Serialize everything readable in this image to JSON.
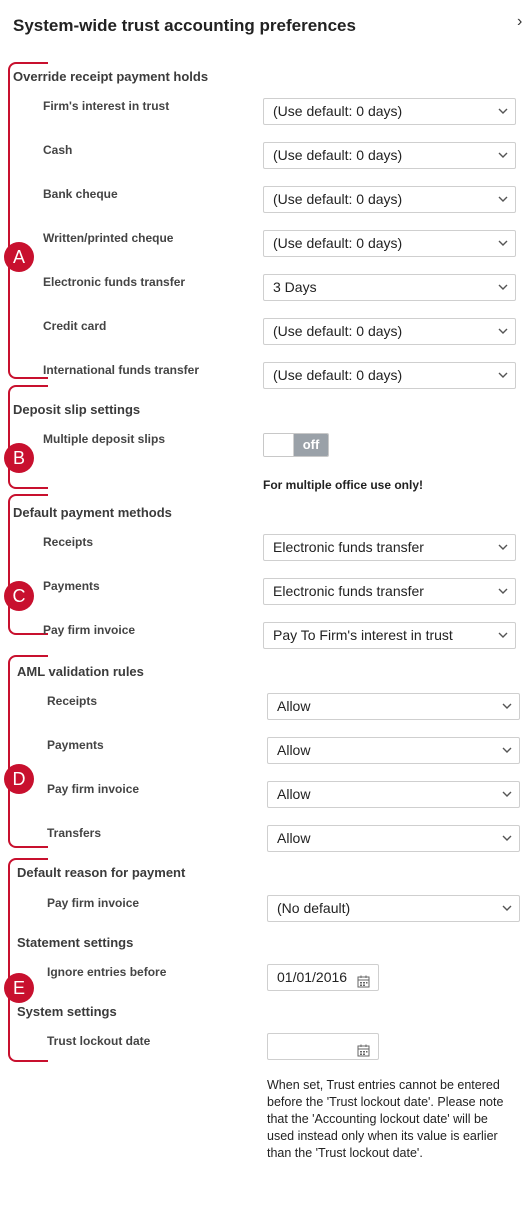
{
  "dialog": {
    "title": "System-wide trust accounting preferences",
    "close_icon": "close-icon",
    "close_glyph": "›"
  },
  "override_holds": {
    "heading": "Override receipt payment holds",
    "rows": [
      {
        "label": "Firm's interest in trust",
        "value": "(Use default: 0 days)"
      },
      {
        "label": "Cash",
        "value": "(Use default: 0 days)"
      },
      {
        "label": "Bank cheque",
        "value": "(Use default: 0 days)"
      },
      {
        "label": "Written/printed cheque",
        "value": "(Use default: 0 days)"
      },
      {
        "label": "Electronic funds transfer",
        "value": "3 Days"
      },
      {
        "label": "Credit card",
        "value": "(Use default: 0 days)"
      },
      {
        "label": "International funds transfer",
        "value": "(Use default: 0 days)"
      }
    ]
  },
  "deposit_slip": {
    "heading": "Deposit slip settings",
    "label": "Multiple deposit slips",
    "toggle_state": "off",
    "note": "For multiple office use only!"
  },
  "payment_methods": {
    "heading": "Default payment methods",
    "rows": [
      {
        "label": "Receipts",
        "value": "Electronic funds transfer"
      },
      {
        "label": "Payments",
        "value": "Electronic funds transfer"
      },
      {
        "label": "Pay firm invoice",
        "value": "Pay To Firm's interest in trust"
      }
    ]
  },
  "aml": {
    "heading": "AML validation rules",
    "rows": [
      {
        "label": "Receipts",
        "value": "Allow"
      },
      {
        "label": "Payments",
        "value": "Allow"
      },
      {
        "label": "Pay firm invoice",
        "value": "Allow"
      },
      {
        "label": "Transfers",
        "value": "Allow"
      }
    ]
  },
  "reason": {
    "heading": "Default reason for payment",
    "label": "Pay firm invoice",
    "value": "(No default)"
  },
  "statement": {
    "heading": "Statement settings",
    "label": "Ignore entries before",
    "value": "01/01/2016"
  },
  "system": {
    "heading": "System settings",
    "label": "Trust lockout date",
    "value": "",
    "note": "When set, Trust entries cannot be entered before the 'Trust lockout date'. Please note that the 'Accounting lockout date' will be used instead only when its value is earlier than the 'Trust lockout date'."
  },
  "annotations": {
    "badges": [
      "A",
      "B",
      "C",
      "D",
      "E"
    ],
    "color": "#c8102e"
  },
  "icons": {
    "dropdown": "chevron-down-icon",
    "date": "calendar-icon"
  }
}
